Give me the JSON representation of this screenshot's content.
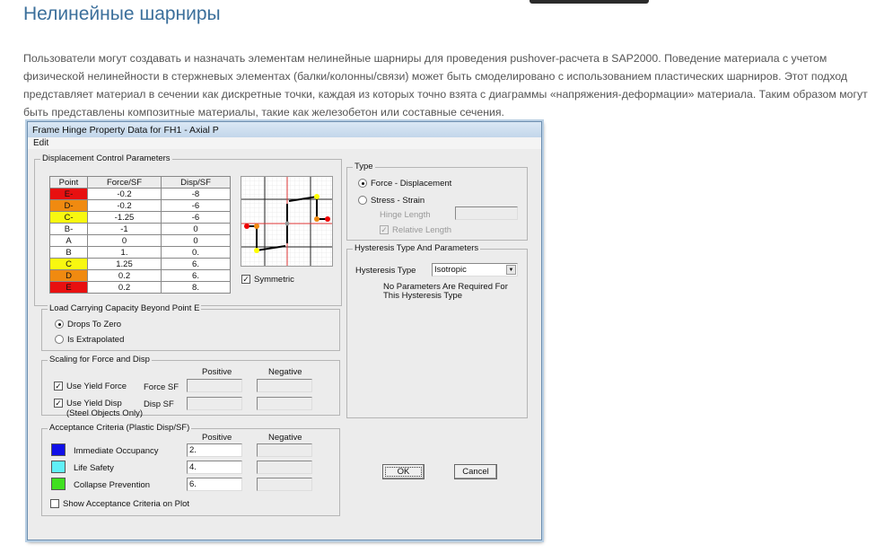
{
  "heading": "Нелинейные шарниры",
  "intro": "Пользователи могут создавать и назначать элементам нелинейные шарниры для проведения pushover-расчета в SAP2000. Поведение материала с учетом физической нелинейности в стержневых элементах (балки/колонны/связи) может быть смоделировано с использованием пластических шарниров. Этот подход представляет материал в сечении как дискретные точки, каждая из которых точно взята с диаграммы «напряжения-деформации» материала. Таким образом могут быть представлены композитные материалы, такие как железобетон или составные сечения.",
  "dialog": {
    "title": "Frame Hinge Property Data for FH1 - Axial P",
    "menu": "Edit",
    "disp_group": "Displacement Control Parameters",
    "table": {
      "headers": [
        "Point",
        "Force/SF",
        "Disp/SF"
      ],
      "rows": [
        {
          "point": "E-",
          "force": "-0.2",
          "disp": "-8",
          "color": "#e81010"
        },
        {
          "point": "D-",
          "force": "-0.2",
          "disp": "-6",
          "color": "#f08a10"
        },
        {
          "point": "C-",
          "force": "-1.25",
          "disp": "-6",
          "color": "#f8f810"
        },
        {
          "point": "B-",
          "force": "-1",
          "disp": "0",
          "color": "#ffffff"
        },
        {
          "point": "A",
          "force": "0",
          "disp": "0",
          "color": "#ffffff"
        },
        {
          "point": "B",
          "force": "1.",
          "disp": "0.",
          "color": "#ffffff"
        },
        {
          "point": "C",
          "force": "1.25",
          "disp": "6.",
          "color": "#f8f810"
        },
        {
          "point": "D",
          "force": "0.2",
          "disp": "6.",
          "color": "#f08a10"
        },
        {
          "point": "E",
          "force": "0.2",
          "disp": "8.",
          "color": "#e81010"
        }
      ]
    },
    "symmetric": "Symmetric",
    "load_group": "Load Carrying Capacity Beyond Point E",
    "drops": "Drops To Zero",
    "extrap": "Is Extrapolated",
    "scale_group": "Scaling for Force and Disp",
    "positive": "Positive",
    "negative": "Negative",
    "use_yield_force": "Use Yield Force",
    "force_sf": "Force SF",
    "use_yield_disp": "Use Yield Disp",
    "steel_only": "(Steel Objects Only)",
    "disp_sf": "Disp SF",
    "accept_group": "Acceptance Criteria (Plastic Disp/SF)",
    "criteria": [
      {
        "label": "Immediate Occupancy",
        "value": "2.",
        "color": "#1010e8"
      },
      {
        "label": "Life Safety",
        "value": "4.",
        "color": "#60f0f8"
      },
      {
        "label": "Collapse Prevention",
        "value": "6.",
        "color": "#40e020"
      }
    ],
    "show_accept": "Show Acceptance Criteria on Plot",
    "type_group": "Type",
    "force_disp": "Force - Displacement",
    "stress_strain": "Stress - Strain",
    "hinge_length": "Hinge Length",
    "relative_length": "Relative Length",
    "hyst_group": "Hysteresis Type And Parameters",
    "hyst_type_label": "Hysteresis Type",
    "hyst_value": "Isotropic",
    "hyst_note": "No Parameters Are Required For This Hysteresis Type",
    "ok": "OK",
    "cancel": "Cancel"
  }
}
